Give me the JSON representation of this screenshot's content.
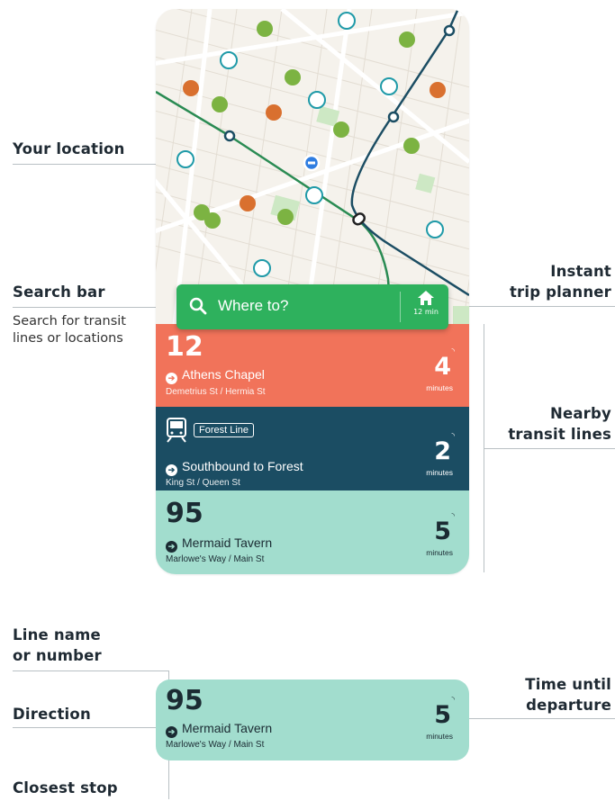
{
  "callouts": {
    "your_location": "Your location",
    "search_bar": "Search bar",
    "search_bar_desc_1": "Search for transit",
    "search_bar_desc_2": "lines or locations",
    "instant_1": "Instant",
    "instant_2": "trip planner",
    "nearby_1": "Nearby",
    "nearby_2": "transit lines",
    "line_name_1": "Line name",
    "line_name_2": "or number",
    "direction": "Direction",
    "closest_stop": "Closest stop",
    "time_1": "Time until",
    "time_2": "departure"
  },
  "search": {
    "placeholder": "Where to?",
    "home_time": "12 min",
    "search_icon": "search-icon",
    "home_icon": "home-icon"
  },
  "routes": [
    {
      "number": "12",
      "destination": "Athens Chapel",
      "stop": "Demetrius St / Hermia St",
      "minutes": "4",
      "minutes_label": "minutes",
      "color": "#f1735a"
    },
    {
      "badge": "Forest Line",
      "destination": "Southbound to Forest",
      "stop": "King St / Queen St",
      "minutes": "2",
      "minutes_label": "minutes",
      "color": "#1b4d63",
      "icon": "train-icon"
    },
    {
      "number": "95",
      "destination": "Mermaid Tavern",
      "stop": "Marlowe's Way / Main St",
      "minutes": "5",
      "minutes_label": "minutes",
      "color": "#a2ddce"
    }
  ],
  "detail": {
    "number": "95",
    "destination": "Mermaid Tavern",
    "stop": "Marlowe's Way / Main St",
    "minutes": "5",
    "minutes_label": "minutes"
  },
  "colors": {
    "green": "#2eb15d",
    "coral": "#f1735a",
    "navy": "#1b4d63",
    "mint": "#a2ddce",
    "map": "#f5f2ec"
  }
}
